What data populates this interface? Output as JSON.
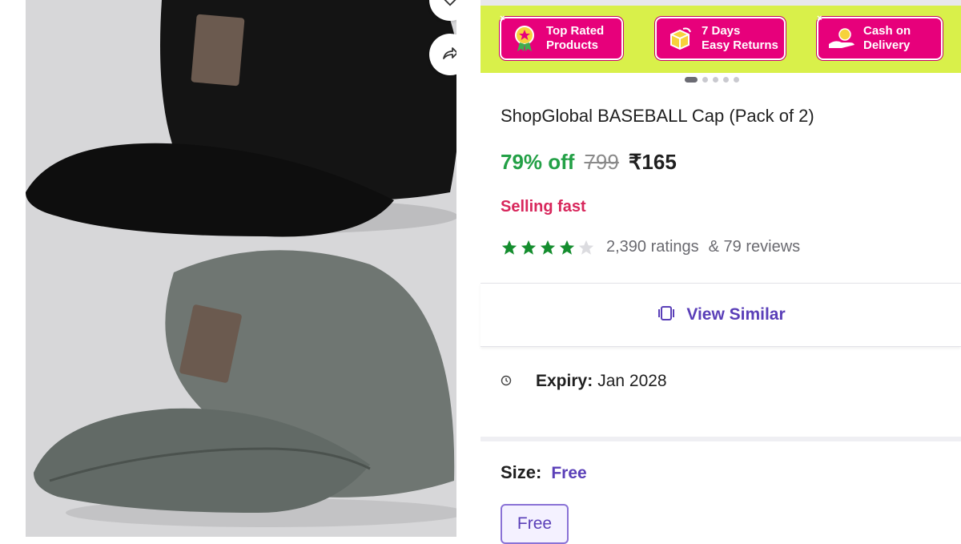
{
  "product_image": {
    "caps": [
      "black",
      "grey"
    ],
    "colors": {
      "black_cap": "#141414",
      "grey_cap": "#6f7672",
      "background": "#d7d7d9"
    }
  },
  "actions": {
    "wishlist_icon": "heart-icon",
    "share_icon": "share-icon"
  },
  "banner": {
    "background": "#d9f04a",
    "badge_color": "#e7007b",
    "close_glyph": "×",
    "badges": [
      {
        "icon": "medal-icon",
        "line1": "Top Rated",
        "line2": "Products"
      },
      {
        "icon": "box-return-icon",
        "line1": "7 Days",
        "line2": "Easy Returns"
      },
      {
        "icon": "cash-hand-icon",
        "line1": "Cash on",
        "line2": "Delivery"
      }
    ]
  },
  "carousel": {
    "total": 5,
    "active": 1
  },
  "product": {
    "title": "ShopGlobal BASEBALL Cap (Pack of 2)",
    "discount": "79% off",
    "mrp": "799",
    "price": "₹165",
    "status": "Selling fast",
    "rating": 4,
    "rating_max": 5,
    "ratings_count": "2,390 ratings",
    "reviews_count": "& 79 reviews"
  },
  "view_similar": {
    "label": "View Similar",
    "icon": "view-similar-icon"
  },
  "expiry": {
    "label": "Expiry:",
    "value": "Jan 2028"
  },
  "size": {
    "label": "Size:",
    "selected": "Free",
    "options": [
      "Free"
    ]
  },
  "colors": {
    "accent": "#5a3fb8",
    "discount": "#23a046",
    "selling": "#d8275c",
    "star": "#148d2e"
  }
}
